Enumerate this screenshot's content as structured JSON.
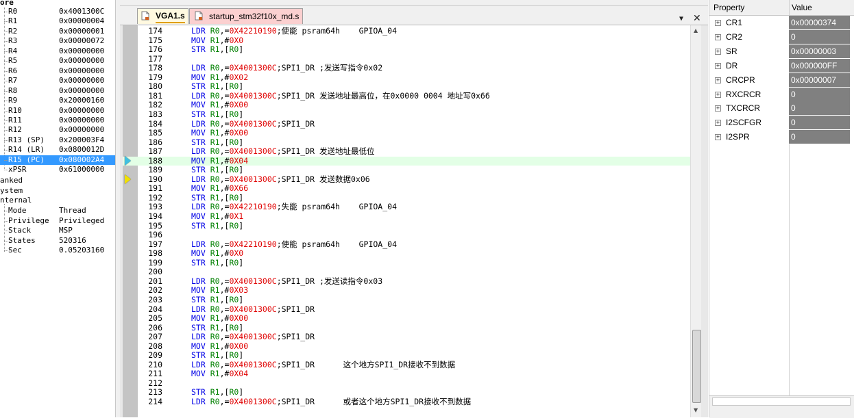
{
  "registers": {
    "core_label": "ore",
    "items": [
      {
        "name": "R0",
        "value": "0x4001300C"
      },
      {
        "name": "R1",
        "value": "0x00000004"
      },
      {
        "name": "R2",
        "value": "0x00000001"
      },
      {
        "name": "R3",
        "value": "0x00000072"
      },
      {
        "name": "R4",
        "value": "0x00000000"
      },
      {
        "name": "R5",
        "value": "0x00000000"
      },
      {
        "name": "R6",
        "value": "0x00000000"
      },
      {
        "name": "R7",
        "value": "0x00000000"
      },
      {
        "name": "R8",
        "value": "0x00000000"
      },
      {
        "name": "R9",
        "value": "0x20000160"
      },
      {
        "name": "R10",
        "value": "0x00000000"
      },
      {
        "name": "R11",
        "value": "0x00000000"
      },
      {
        "name": "R12",
        "value": "0x00000000"
      },
      {
        "name": "R13 (SP)",
        "value": "0x200003F4"
      },
      {
        "name": "R14 (LR)",
        "value": "0x0800012D"
      },
      {
        "name": "R15 (PC)",
        "value": "0x080002A4"
      },
      {
        "name": "xPSR",
        "value": "0x61000000"
      }
    ],
    "groups": [
      "anked",
      "ystem",
      "nternal"
    ],
    "internal": [
      {
        "name": "Mode",
        "value": "Thread"
      },
      {
        "name": "Privilege",
        "value": "Privileged"
      },
      {
        "name": "Stack",
        "value": "MSP"
      },
      {
        "name": "States",
        "value": "520316"
      },
      {
        "name": "Sec",
        "value": "0.05203160"
      }
    ]
  },
  "editor": {
    "tabs": [
      {
        "label": "VGA1.s"
      },
      {
        "label": "startup_stm32f10x_md.s"
      }
    ],
    "dropdown_icon": "▼",
    "close_icon": "✕",
    "current_line": 188,
    "lines": [
      {
        "num": "174",
        "op": "LDR",
        "rest": [
          [
            "rg",
            "R0"
          ],
          [
            "pc",
            ",="
          ],
          [
            "num",
            "0X42210190"
          ],
          [
            "cmt",
            ";使能 psram64h    GPIOA_04"
          ]
        ]
      },
      {
        "num": "175",
        "op": "MOV",
        "rest": [
          [
            "rg",
            "R1"
          ],
          [
            "pc",
            ",#"
          ],
          [
            "num",
            "0X0"
          ]
        ]
      },
      {
        "num": "176",
        "op": "STR",
        "rest": [
          [
            "rg",
            "R1"
          ],
          [
            "pc",
            ",["
          ],
          [
            "rg",
            "R0"
          ],
          [
            "pc",
            "]"
          ]
        ]
      },
      {
        "num": "177",
        "op": "",
        "rest": []
      },
      {
        "num": "178",
        "op": "LDR",
        "rest": [
          [
            "rg",
            "R0"
          ],
          [
            "pc",
            ",="
          ],
          [
            "num",
            "0X4001300C"
          ],
          [
            "cmt",
            ";SPI1_DR ;发送写指令0x02"
          ]
        ]
      },
      {
        "num": "179",
        "op": "MOV",
        "rest": [
          [
            "rg",
            "R1"
          ],
          [
            "pc",
            ",#"
          ],
          [
            "num",
            "0X02"
          ]
        ]
      },
      {
        "num": "180",
        "op": "STR",
        "rest": [
          [
            "rg",
            "R1"
          ],
          [
            "pc",
            ",["
          ],
          [
            "rg",
            "R0"
          ],
          [
            "pc",
            "]"
          ]
        ]
      },
      {
        "num": "181",
        "op": "LDR",
        "rest": [
          [
            "rg",
            "R0"
          ],
          [
            "pc",
            ",="
          ],
          [
            "num",
            "0X4001300C"
          ],
          [
            "cmt",
            ";SPI1_DR 发送地址最高位，在0x0000 0004 地址写0x66"
          ]
        ]
      },
      {
        "num": "182",
        "op": "MOV",
        "rest": [
          [
            "rg",
            "R1"
          ],
          [
            "pc",
            ",#"
          ],
          [
            "num",
            "0X00"
          ]
        ]
      },
      {
        "num": "183",
        "op": "STR",
        "rest": [
          [
            "rg",
            "R1"
          ],
          [
            "pc",
            ",["
          ],
          [
            "rg",
            "R0"
          ],
          [
            "pc",
            "]"
          ]
        ]
      },
      {
        "num": "184",
        "op": "LDR",
        "rest": [
          [
            "rg",
            "R0"
          ],
          [
            "pc",
            ",="
          ],
          [
            "num",
            "0X4001300C"
          ],
          [
            "cmt",
            ";SPI1_DR"
          ]
        ]
      },
      {
        "num": "185",
        "op": "MOV",
        "rest": [
          [
            "rg",
            "R1"
          ],
          [
            "pc",
            ",#"
          ],
          [
            "num",
            "0X00"
          ]
        ]
      },
      {
        "num": "186",
        "op": "STR",
        "rest": [
          [
            "rg",
            "R1"
          ],
          [
            "pc",
            ",["
          ],
          [
            "rg",
            "R0"
          ],
          [
            "pc",
            "]"
          ]
        ]
      },
      {
        "num": "187",
        "op": "LDR",
        "rest": [
          [
            "rg",
            "R0"
          ],
          [
            "pc",
            ",="
          ],
          [
            "num",
            "0X4001300C"
          ],
          [
            "cmt",
            ";SPI1_DR 发送地址最低位"
          ]
        ]
      },
      {
        "num": "188",
        "op": "MOV",
        "rest": [
          [
            "rg",
            "R1"
          ],
          [
            "pc",
            ",#"
          ],
          [
            "num",
            "0X04"
          ]
        ]
      },
      {
        "num": "189",
        "op": "STR",
        "rest": [
          [
            "rg",
            "R1"
          ],
          [
            "pc",
            ",["
          ],
          [
            "rg",
            "R0"
          ],
          [
            "pc",
            "]"
          ]
        ]
      },
      {
        "num": "190",
        "op": "LDR",
        "rest": [
          [
            "rg",
            "R0"
          ],
          [
            "pc",
            ",="
          ],
          [
            "num",
            "0X4001300C"
          ],
          [
            "cmt",
            ";SPI1_DR 发送数据0x06"
          ]
        ]
      },
      {
        "num": "191",
        "op": "MOV",
        "rest": [
          [
            "rg",
            "R1"
          ],
          [
            "pc",
            ",#"
          ],
          [
            "num",
            "0X66"
          ]
        ]
      },
      {
        "num": "192",
        "op": "STR",
        "rest": [
          [
            "rg",
            "R1"
          ],
          [
            "pc",
            ",["
          ],
          [
            "rg",
            "R0"
          ],
          [
            "pc",
            "]"
          ]
        ]
      },
      {
        "num": "193",
        "op": "LDR",
        "rest": [
          [
            "rg",
            "R0"
          ],
          [
            "pc",
            ",="
          ],
          [
            "num",
            "0X42210190"
          ],
          [
            "cmt",
            ";失能 psram64h    GPIOA_04"
          ]
        ]
      },
      {
        "num": "194",
        "op": "MOV",
        "rest": [
          [
            "rg",
            "R1"
          ],
          [
            "pc",
            ",#"
          ],
          [
            "num",
            "0X1"
          ]
        ]
      },
      {
        "num": "195",
        "op": "STR",
        "rest": [
          [
            "rg",
            "R1"
          ],
          [
            "pc",
            ",["
          ],
          [
            "rg",
            "R0"
          ],
          [
            "pc",
            "]"
          ]
        ]
      },
      {
        "num": "196",
        "op": "",
        "rest": []
      },
      {
        "num": "197",
        "op": "LDR",
        "rest": [
          [
            "rg",
            "R0"
          ],
          [
            "pc",
            ",="
          ],
          [
            "num",
            "0X42210190"
          ],
          [
            "cmt",
            ";使能 psram64h    GPIOA_04"
          ]
        ]
      },
      {
        "num": "198",
        "op": "MOV",
        "rest": [
          [
            "rg",
            "R1"
          ],
          [
            "pc",
            ",#"
          ],
          [
            "num",
            "0X0"
          ]
        ]
      },
      {
        "num": "199",
        "op": "STR",
        "rest": [
          [
            "rg",
            "R1"
          ],
          [
            "pc",
            ",["
          ],
          [
            "rg",
            "R0"
          ],
          [
            "pc",
            "]"
          ]
        ]
      },
      {
        "num": "200",
        "op": "",
        "rest": []
      },
      {
        "num": "201",
        "op": "LDR",
        "rest": [
          [
            "rg",
            "R0"
          ],
          [
            "pc",
            ",="
          ],
          [
            "num",
            "0X4001300C"
          ],
          [
            "cmt",
            ";SPI1_DR ;发送读指令0x03"
          ]
        ]
      },
      {
        "num": "202",
        "op": "MOV",
        "rest": [
          [
            "rg",
            "R1"
          ],
          [
            "pc",
            ",#"
          ],
          [
            "num",
            "0X03"
          ]
        ]
      },
      {
        "num": "203",
        "op": "STR",
        "rest": [
          [
            "rg",
            "R1"
          ],
          [
            "pc",
            ",["
          ],
          [
            "rg",
            "R0"
          ],
          [
            "pc",
            "]"
          ]
        ]
      },
      {
        "num": "204",
        "op": "LDR",
        "rest": [
          [
            "rg",
            "R0"
          ],
          [
            "pc",
            ",="
          ],
          [
            "num",
            "0X4001300C"
          ],
          [
            "cmt",
            ";SPI1_DR"
          ]
        ]
      },
      {
        "num": "205",
        "op": "MOV",
        "rest": [
          [
            "rg",
            "R1"
          ],
          [
            "pc",
            ",#"
          ],
          [
            "num",
            "0X00"
          ]
        ]
      },
      {
        "num": "206",
        "op": "STR",
        "rest": [
          [
            "rg",
            "R1"
          ],
          [
            "pc",
            ",["
          ],
          [
            "rg",
            "R0"
          ],
          [
            "pc",
            "]"
          ]
        ]
      },
      {
        "num": "207",
        "op": "LDR",
        "rest": [
          [
            "rg",
            "R0"
          ],
          [
            "pc",
            ",="
          ],
          [
            "num",
            "0X4001300C"
          ],
          [
            "cmt",
            ";SPI1_DR"
          ]
        ]
      },
      {
        "num": "208",
        "op": "MOV",
        "rest": [
          [
            "rg",
            "R1"
          ],
          [
            "pc",
            ",#"
          ],
          [
            "num",
            "0X00"
          ]
        ]
      },
      {
        "num": "209",
        "op": "STR",
        "rest": [
          [
            "rg",
            "R1"
          ],
          [
            "pc",
            ",["
          ],
          [
            "rg",
            "R0"
          ],
          [
            "pc",
            "]"
          ]
        ]
      },
      {
        "num": "210",
        "op": "LDR",
        "rest": [
          [
            "rg",
            "R0"
          ],
          [
            "pc",
            ",="
          ],
          [
            "num",
            "0X4001300C"
          ],
          [
            "cmt",
            ";SPI1_DR      这个地方SPI1_DR接收不到数据"
          ]
        ]
      },
      {
        "num": "211",
        "op": "MOV",
        "rest": [
          [
            "rg",
            "R1"
          ],
          [
            "pc",
            ",#"
          ],
          [
            "num",
            "0X04"
          ]
        ]
      },
      {
        "num": "212",
        "op": "",
        "rest": []
      },
      {
        "num": "213",
        "op": "STR",
        "rest": [
          [
            "rg",
            "R1"
          ],
          [
            "pc",
            ",["
          ],
          [
            "rg",
            "R0"
          ],
          [
            "pc",
            "]"
          ]
        ]
      },
      {
        "num": "214",
        "op": "LDR",
        "rest": [
          [
            "rg",
            "R0"
          ],
          [
            "pc",
            ",="
          ],
          [
            "num",
            "0X4001300C"
          ],
          [
            "cmt",
            ";SPI1_DR      或者这个地方SPI1_DR接收不到数据"
          ]
        ]
      }
    ],
    "markers": [
      {
        "line": "188",
        "type": "pc-arrow",
        "color": "#40c0e0"
      },
      {
        "line": "190",
        "type": "cursor-arrow",
        "color": "#f0e000"
      }
    ]
  },
  "properties": {
    "header_property": "Property",
    "header_value": "Value",
    "rows": [
      {
        "name": "CR1",
        "value": "0x00000374"
      },
      {
        "name": "CR2",
        "value": "0"
      },
      {
        "name": "SR",
        "value": "0x00000003"
      },
      {
        "name": "DR",
        "value": "0x000000FF"
      },
      {
        "name": "CRCPR",
        "value": "0x00000007"
      },
      {
        "name": "RXCRCR",
        "value": "0"
      },
      {
        "name": "TXCRCR",
        "value": "0"
      },
      {
        "name": "I2SCFGR",
        "value": "0"
      },
      {
        "name": "I2SPR",
        "value": "0"
      }
    ]
  }
}
